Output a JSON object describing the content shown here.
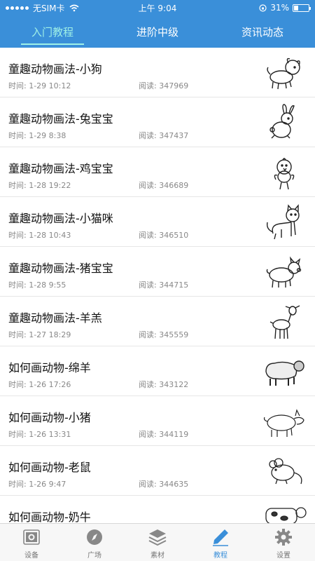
{
  "status_bar": {
    "carrier": "无SIM卡",
    "time": "上午 9:04",
    "battery": "31%",
    "battery_level": 0.31
  },
  "tabs": [
    {
      "label": "入门教程",
      "active": true
    },
    {
      "label": "进阶中级",
      "active": false
    },
    {
      "label": "资讯动态",
      "active": false
    }
  ],
  "items": [
    {
      "title": "童趣动物画法-小狗",
      "time": "时间: 1-29 10:12",
      "reads": "阅读: 347969",
      "icon": "puppy-drawing"
    },
    {
      "title": "童趣动物画法-兔宝宝",
      "time": "时间: 1-29 8:38",
      "reads": "阅读: 347437",
      "icon": "bunny-drawing"
    },
    {
      "title": "童趣动物画法-鸡宝宝",
      "time": "时间: 1-28 19:22",
      "reads": "阅读: 346689",
      "icon": "chick-drawing"
    },
    {
      "title": "童趣动物画法-小猫咪",
      "time": "时间: 1-28 10:43",
      "reads": "阅读: 346510",
      "icon": "kitten-drawing"
    },
    {
      "title": "童趣动物画法-猪宝宝",
      "time": "时间: 1-28 9:55",
      "reads": "阅读: 344715",
      "icon": "piglet-drawing"
    },
    {
      "title": "童趣动物画法-羊羔",
      "time": "时间: 1-27 18:29",
      "reads": "阅读: 345559",
      "icon": "lamb-drawing"
    },
    {
      "title": "如何画动物-绵羊",
      "time": "时间: 1-26 17:26",
      "reads": "阅读: 343122",
      "icon": "sheep-drawing"
    },
    {
      "title": "如何画动物-小猪",
      "time": "时间: 1-26 13:31",
      "reads": "阅读: 344119",
      "icon": "pig-drawing"
    },
    {
      "title": "如何画动物-老鼠",
      "time": "时间: 1-26 9:47",
      "reads": "阅读: 344635",
      "icon": "mouse-drawing"
    },
    {
      "title": "如何画动物-奶牛",
      "time": "",
      "reads": "",
      "icon": "cow-drawing"
    }
  ],
  "bottom_nav": [
    {
      "label": "设备",
      "icon": "camera-icon",
      "active": false
    },
    {
      "label": "广场",
      "icon": "compass-icon",
      "active": false
    },
    {
      "label": "素材",
      "icon": "layers-icon",
      "active": false
    },
    {
      "label": "教程",
      "icon": "pencil-icon",
      "active": true
    },
    {
      "label": "设置",
      "icon": "gear-icon",
      "active": false
    }
  ],
  "colors": {
    "header": "#3a8fd9",
    "active_tab": "#9ff0e6",
    "active_nav": "#3a8fd9"
  }
}
